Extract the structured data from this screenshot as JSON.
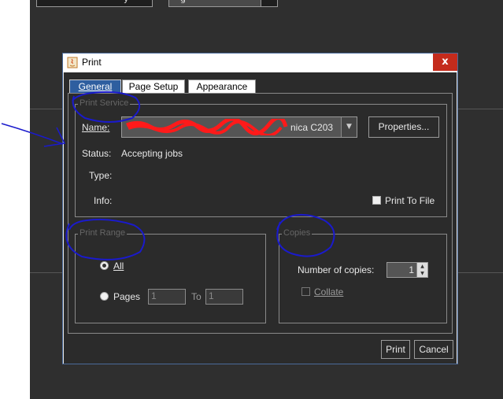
{
  "background": {
    "field_text": "y",
    "field2_text": "g"
  },
  "dialog": {
    "title": "Print",
    "close_glyph": "x",
    "tabs": [
      {
        "label": "General",
        "active": true
      },
      {
        "label": "Page Setup",
        "active": false
      },
      {
        "label": "Appearance",
        "active": false
      }
    ],
    "print_service": {
      "group_title": "Print Service",
      "name_label": "Name:",
      "printer_name_visible": "nica C203",
      "status_label": "Status:",
      "status_value": "Accepting jobs",
      "type_label": "Type:",
      "info_label": "Info:",
      "properties_button": "Properties...",
      "print_to_file_label": "Print To File",
      "print_to_file_checked": false
    },
    "print_range": {
      "group_title": "Print Range",
      "all_label": "All",
      "all_selected": true,
      "pages_label": "Pages",
      "pages_from": "1",
      "to_label": "To",
      "pages_to": "1"
    },
    "copies": {
      "group_title": "Copies",
      "number_label": "Number of copies:",
      "number_value": "1",
      "collate_label": "Collate",
      "collate_checked": false
    },
    "buttons": {
      "print": "Print",
      "cancel": "Cancel"
    }
  },
  "colors": {
    "background_dark": "#2f2f2f",
    "dialog_body": "#2b2b2b",
    "active_tab": "#2e5e9f",
    "close_button": "#c42b1c",
    "annotation_ink": "#1a1acc",
    "redaction": "#ff1a1a"
  }
}
